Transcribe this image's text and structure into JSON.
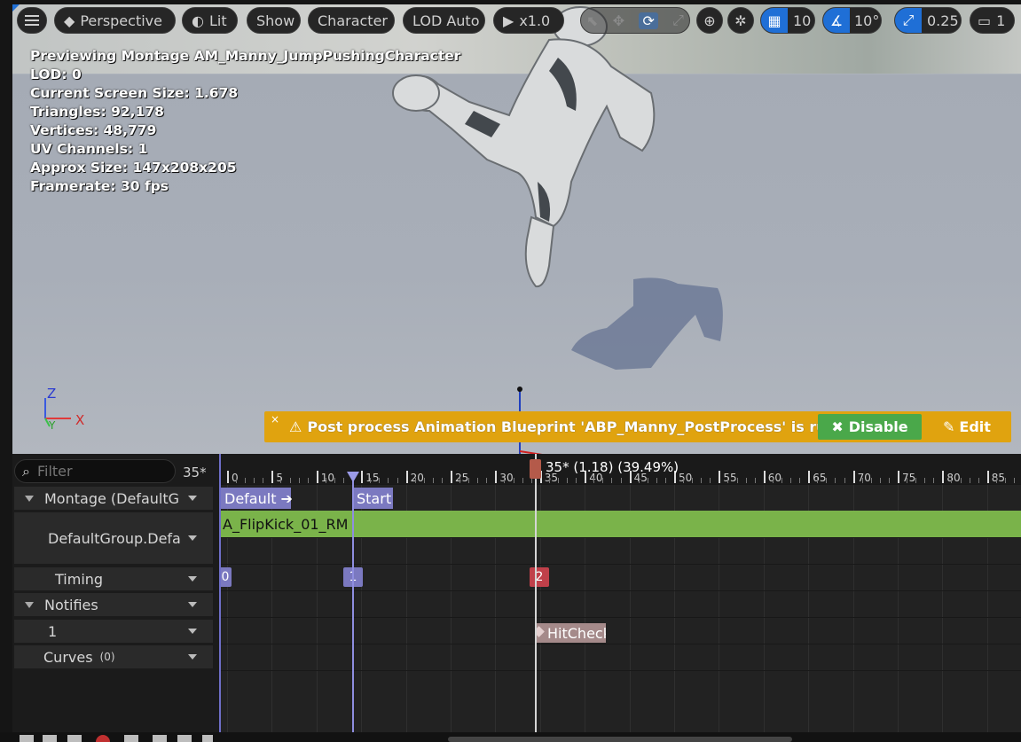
{
  "toolbar": {
    "perspective": "Perspective",
    "lit": "Lit",
    "show": "Show",
    "character": "Character",
    "lod": "LOD Auto",
    "play_speed": "x1.0",
    "grid_size": "10",
    "rotation_snap": "10°",
    "scale_snap": "0.25",
    "camera_count": "1"
  },
  "stats": {
    "line1": "Previewing Montage AM_Manny_JumpPushingCharacter",
    "line2": "LOD: 0",
    "line3": "Current Screen Size: 1.678",
    "line4": "Triangles: 92,178",
    "line5": "Vertices: 48,779",
    "line6": "UV Channels: 1",
    "line7": "Approx Size: 147x208x205",
    "line8": "Framerate: 30 fps"
  },
  "axes": {
    "z": "Z",
    "x": "X",
    "y": "Y"
  },
  "banner": {
    "close": "×",
    "message": "Post process Animation Blueprint 'ABP_Manny_PostProcess' is running.",
    "disable": "Disable",
    "edit": "Edit"
  },
  "filter": {
    "placeholder": "Filter",
    "frame": "35*"
  },
  "tracks": {
    "montage": "Montage (DefaultG",
    "group": "DefaultGroup.Defa",
    "timing": "Timing",
    "notifies": "Notifies",
    "notify_track": "1",
    "curves": "Curves",
    "curves_count": "(0)"
  },
  "timeline": {
    "ticks": [
      "0",
      "5",
      "10",
      "15",
      "20",
      "25",
      "30",
      "35",
      "40",
      "45",
      "50",
      "55",
      "60",
      "65",
      "70",
      "75",
      "80",
      "85"
    ],
    "scrub_label": "35* (1.18) (39.49%)",
    "section_default": "Default",
    "section_start": "Start",
    "segment": "A_FlipKick_01_RM",
    "timing_0": "0",
    "timing_1": "1",
    "timing_2": "2",
    "notify": "HitCheck"
  },
  "colors": {
    "accent": "#1f6fd6",
    "banner": "#e0a30f",
    "disable_button": "#4aa84a",
    "segment": "#7ab34a",
    "section": "#7b79c0",
    "notify": "#a58a8a"
  }
}
